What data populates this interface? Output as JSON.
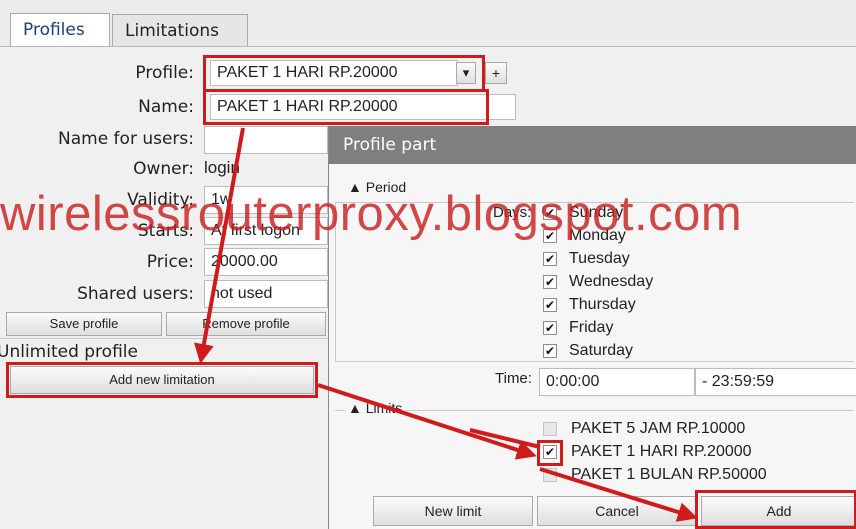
{
  "tabs": {
    "profiles": "Profiles",
    "limitations": "Limitations"
  },
  "form": {
    "profile_label": "Profile:",
    "profile_value": "PAKET 1 HARI RP.20000",
    "add_profile_symbol": "+",
    "dropdown_symbol": "▾",
    "name_label": "Name:",
    "name_value": "PAKET 1 HARI RP.20000",
    "name_for_users_label": "Name for users:",
    "name_for_users_value": "",
    "owner_label": "Owner:",
    "owner_value": "login",
    "validity_label": "Validity:",
    "validity_value": "1w",
    "starts_label": "Starts:",
    "starts_value": "At first logon",
    "price_label": "Price:",
    "price_value": "20000.00",
    "shared_users_label": "Shared users:",
    "shared_users_value": "not used",
    "save_profile": "Save profile",
    "remove_profile": "Remove profile",
    "unlimited_profile": "Unlimited profile",
    "add_new_limitation": "Add new limitation"
  },
  "dialog": {
    "title": "Profile part",
    "period_label": "▲ Period",
    "days_label": "Days:",
    "days": [
      "Sunday",
      "Monday",
      "Tuesday",
      "Wednesday",
      "Thursday",
      "Friday",
      "Saturday"
    ],
    "check_mark": "✔",
    "time_label": "Time:",
    "time_from": "0:00:00",
    "time_to": "- 23:59:59",
    "limits_label": "▲ Limits",
    "limits": [
      {
        "label": "PAKET 5 JAM RP.10000",
        "checked": false
      },
      {
        "label": "PAKET 1 HARI RP.20000",
        "checked": true
      },
      {
        "label": "PAKET 1 BULAN RP.50000",
        "checked": false
      }
    ],
    "new_limit": "New limit",
    "cancel": "Cancel",
    "add": "Add"
  },
  "watermark": "wirelessrouterproxy.blogspot.com",
  "colors": {
    "highlight": "#d01b1b",
    "titlebar": "#7f7f7f"
  }
}
